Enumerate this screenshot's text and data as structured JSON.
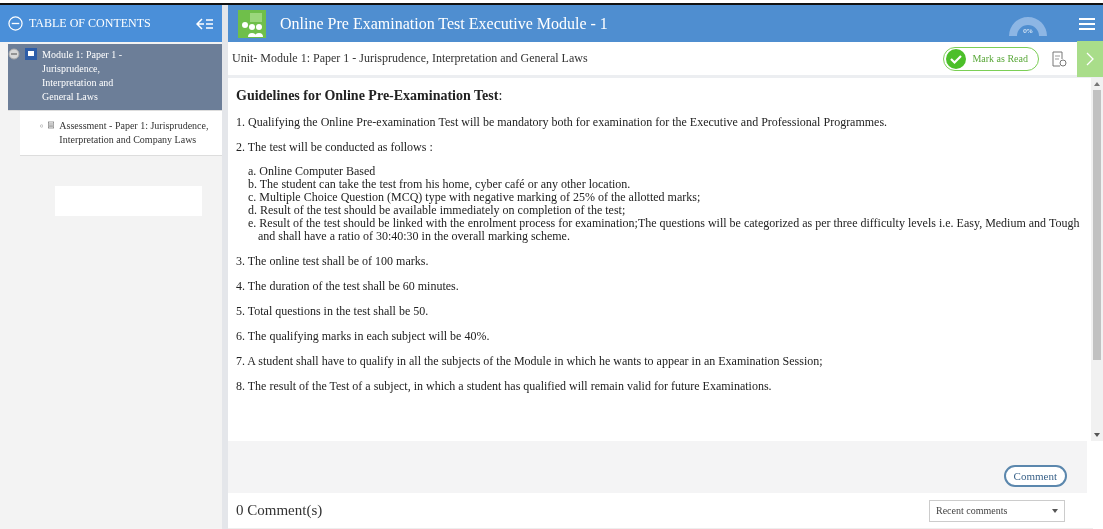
{
  "sidebar": {
    "title": "TABLE OF CONTENTS",
    "items": [
      {
        "label": "Module 1: Paper 1 - Jurisprudence, Interpretation and General Laws",
        "kind": "module",
        "selected": true,
        "expanded": true,
        "children": [
          {
            "label": "Assessment -  Paper 1: Jurisprudence, Interpretation and Company Laws",
            "kind": "assessment",
            "selected": false
          }
        ]
      }
    ]
  },
  "header": {
    "title": "Online Pre Examination Test Executive Module - 1",
    "progress": "0%"
  },
  "unit": {
    "title": "Unit- Module 1: Paper 1 - Jurisprudence, Interpretation and General Laws",
    "mark_as_read": "Mark as Read"
  },
  "content": {
    "heading": "Guidelines for Online Pre-Examination Test",
    "heading_suffix": ":",
    "points": [
      {
        "text": "1. Qualifying the Online Pre-examination Test will be mandatory both for examination for the Executive and Professional Programmes."
      },
      {
        "text": "2. The test will be conducted as follows :",
        "subpoints": [
          "a. Online Computer Based",
          "b. The student can take the test from his home, cyber café or any other location.",
          "c. Multiple Choice Question (MCQ) type with negative marking of 25% of the allotted marks;",
          "d. Result of the test should be available immediately on completion of the test;",
          "e. Result of the test should be linked with the enrolment process for examination;The questions will be categorized as per three difficulty levels i.e. Easy, Medium and Tough and shall have a ratio of 30:40:30 in the overall marking scheme."
        ]
      },
      {
        "text": "3. The online test shall be of 100 marks."
      },
      {
        "text": "4. The duration of the test shall be 60 minutes."
      },
      {
        "text": "5. Total questions in the test shall be 50."
      },
      {
        "text": "6. The qualifying marks in each subject will be 40%."
      },
      {
        "text": "7. A student shall have to qualify in all the subjects of the Module in which he wants to appear in an Examination Session;"
      },
      {
        "text": "8. The result of the Test of a subject, in which a student has qualified will remain valid for future Examinations."
      }
    ]
  },
  "comments": {
    "button": "Comment",
    "count": "0 Comment(s)",
    "sort": "Recent comments"
  }
}
